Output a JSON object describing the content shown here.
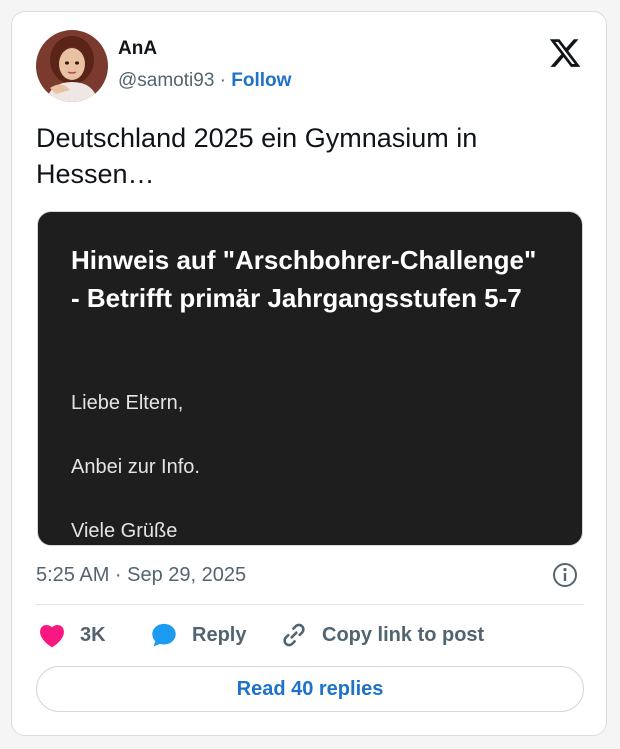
{
  "author": {
    "name": "AnA",
    "handle": "@samoti93",
    "separator": "·",
    "follow_label": "Follow"
  },
  "tweet": {
    "text": "Deutschland 2025 ein Gymnasium in Hessen…",
    "timestamp": "5:25 AM · Sep 29, 2025"
  },
  "media": {
    "title": "Hinweis auf \"Arschbohrer-Challenge\" - Betrifft primär Jahrgangsstufen 5-7",
    "lines": [
      "Liebe Eltern,",
      "Anbei zur Info.",
      "Viele Grüße"
    ]
  },
  "actions": {
    "like_count": "3K",
    "reply_label": "Reply",
    "copy_link_label": "Copy link to post"
  },
  "footer": {
    "read_replies_label": "Read 40 replies"
  },
  "colors": {
    "accent": "#1d73c9",
    "like": "#f91880",
    "media_bg": "#1e1e1f"
  },
  "icons": [
    "x-logo-icon",
    "info-icon",
    "heart-icon",
    "reply-bubble-icon",
    "link-icon"
  ]
}
